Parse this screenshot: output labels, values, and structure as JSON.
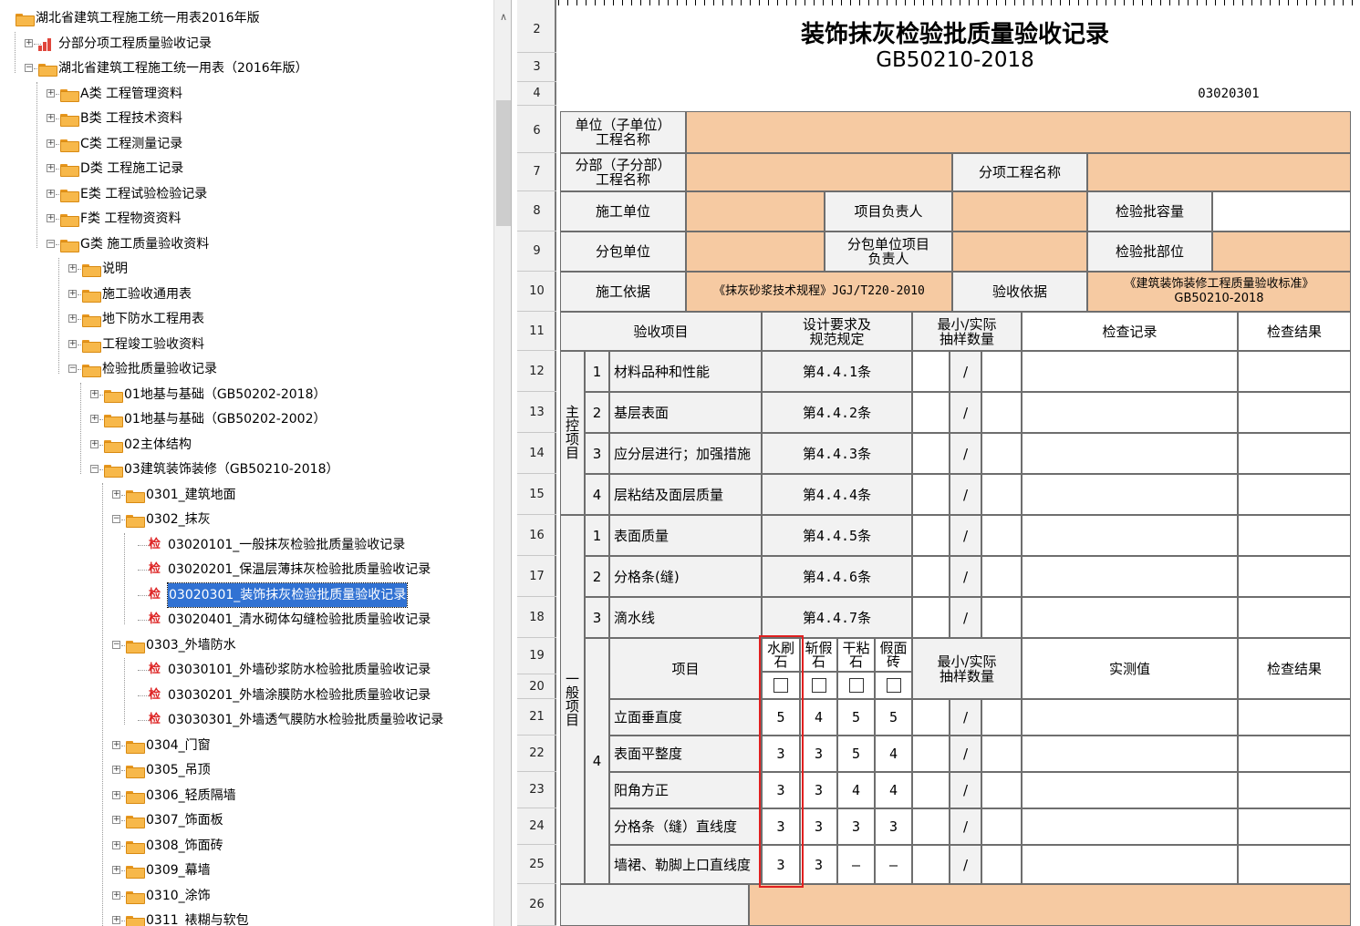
{
  "tree": {
    "root": "湖北省建筑工程施工统一用表2016年版",
    "n1": "分部分项工程质量验收记录",
    "n2": "湖北省建筑工程施工统一用表（2016年版）",
    "a": "A类 工程管理资料",
    "b": "B类 工程技术资料",
    "c": "C类 工程测量记录",
    "d": "D类 工程施工记录",
    "e": "E类 工程试验检验记录",
    "f": "F类 工程物资资料",
    "g": "G类 施工质量验收资料",
    "g1": "说明",
    "g2": "施工验收通用表",
    "g3": "地下防水工程用表",
    "g4": "工程竣工验收资料",
    "g5": "检验批质量验收记录",
    "s1": "01地基与基础（GB50202-2018）",
    "s2": "01地基与基础（GB50202-2002）",
    "s3": "02主体结构",
    "s4": "03建筑装饰装修（GB50210-2018）",
    "s4a": "0301_建筑地面",
    "s4b": "0302_抹灰",
    "i1": "03020101_一般抹灰检验批质量验收记录",
    "i2": "03020201_保温层薄抹灰检验批质量验收记录",
    "i3": "03020301_装饰抹灰检验批质量验收记录",
    "i4": "03020401_清水砌体勾缝检验批质量验收记录",
    "s4c": "0303_外墙防水",
    "j1": "03030101_外墙砂浆防水检验批质量验收记录",
    "j2": "03030201_外墙涂膜防水检验批质量验收记录",
    "j3": "03030301_外墙透气膜防水检验批质量验收记录",
    "k1": "0304_门窗",
    "k2": "0305_吊顶",
    "k3": "0306_轻质隔墙",
    "k4": "0307_饰面板",
    "k5": "0308_饰面砖",
    "k6": "0309_幕墙",
    "k7": "0310_涂饰",
    "k8": "0311_裱糊与软包",
    "check_icon": "检"
  },
  "rows": [
    "2",
    "3",
    "4",
    "6",
    "7",
    "8",
    "9",
    "10",
    "11",
    "12",
    "13",
    "14",
    "15",
    "16",
    "17",
    "18",
    "19",
    "20",
    "21",
    "22",
    "23",
    "24",
    "25",
    "26"
  ],
  "form": {
    "title": "装饰抹灰检验批质量验收记录",
    "std": "GB50210-2018",
    "code": "03020301",
    "unit": "单位（子单位）\n工程名称",
    "sub": "分部（子分部）\n工程名称",
    "item_name": "分项工程名称",
    "builder": "施工单位",
    "manager": "项目负责人",
    "capacity": "检验批容量",
    "subcon": "分包单位",
    "subcon_mgr": "分包单位项目\n负责人",
    "part": "检验批部位",
    "basis": "施工依据",
    "basis_val": "《抹灰砂浆技术规程》JGJ/T220-2010",
    "accept": "验收依据",
    "accept_val": "《建筑装饰装修工程质量验收标准》\nGB50210-2018",
    "h_item": "验收项目",
    "h_req": "设计要求及\n规范规定",
    "h_min": "最小/实际\n抽样数量",
    "h_rec": "检查记录",
    "h_res": "检查结果",
    "main": "主\n控\n项\n目",
    "general": "一\n般\n项\n目",
    "slash": "/",
    "four": "4",
    "m": [
      {
        "n": "1",
        "t": "材料品种和性能",
        "r": "第4.4.1条"
      },
      {
        "n": "2",
        "t": "基层表面",
        "r": "第4.4.2条"
      },
      {
        "n": "3",
        "t": "应分层进行；加强措施",
        "r": "第4.4.3条"
      },
      {
        "n": "4",
        "t": "层粘结及面层质量",
        "r": "第4.4.4条"
      }
    ],
    "g": [
      {
        "n": "1",
        "t": "表面质量",
        "r": "第4.4.5条"
      },
      {
        "n": "2",
        "t": "分格条(缝)",
        "r": "第4.4.6条"
      },
      {
        "n": "3",
        "t": "滴水线",
        "r": "第4.4.7条"
      }
    ],
    "t_item": "项目",
    "types": [
      "水刷\n石",
      "斩假\n石",
      "干粘\n石",
      "假面\n砖"
    ],
    "t_actual": "实测值",
    "dev": [
      {
        "t": "立面垂直度",
        "v": [
          "5",
          "4",
          "5",
          "5"
        ]
      },
      {
        "t": "表面平整度",
        "v": [
          "3",
          "3",
          "5",
          "4"
        ]
      },
      {
        "t": "阳角方正",
        "v": [
          "3",
          "3",
          "4",
          "4"
        ]
      },
      {
        "t": "分格条（缝）直线度",
        "v": [
          "3",
          "3",
          "3",
          "3"
        ]
      },
      {
        "t": "墙裙、勒脚上口直线度",
        "v": [
          "3",
          "3",
          "—",
          "—"
        ]
      }
    ]
  },
  "colors": {
    "fill": "#f6caa2",
    "highlight": "#e02020",
    "selection": "#3172d3"
  }
}
